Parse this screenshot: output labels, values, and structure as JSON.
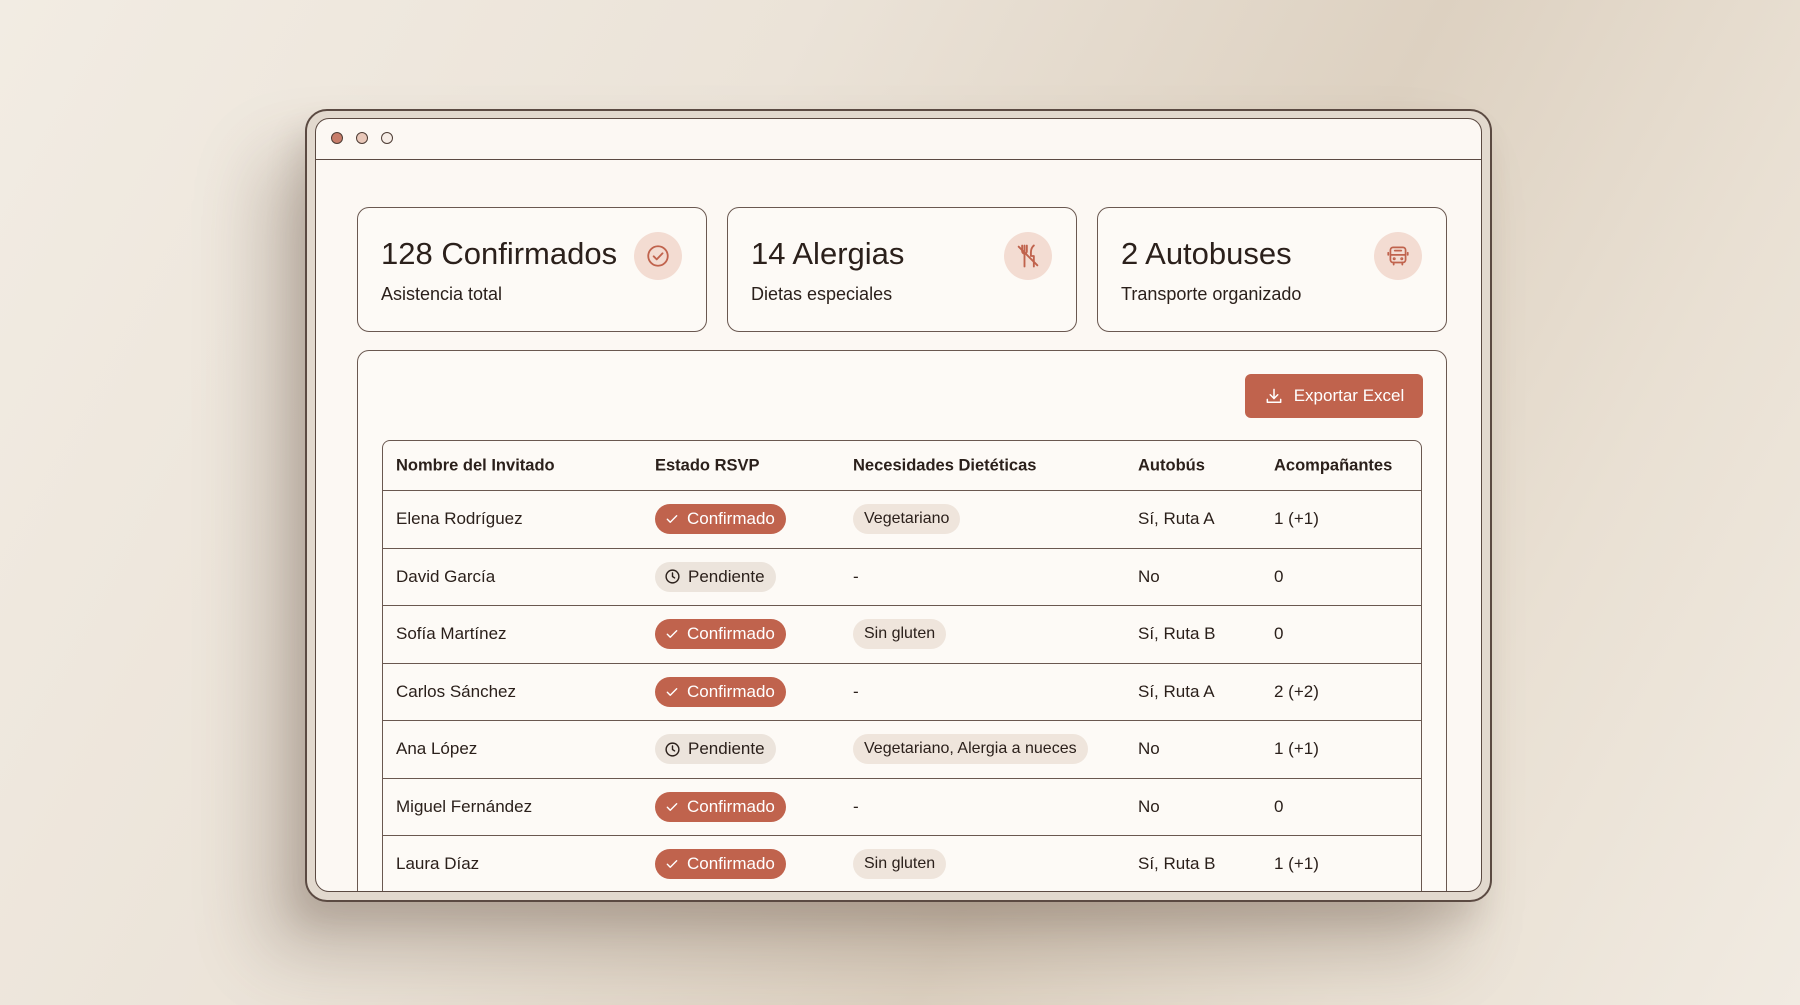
{
  "stats": [
    {
      "title": "128 Confirmados",
      "subtitle": "Asistencia total",
      "icon": "check-circle-icon"
    },
    {
      "title": "14 Alergias",
      "subtitle": "Dietas especiales",
      "icon": "no-utensils-icon"
    },
    {
      "title": "2 Autobuses",
      "subtitle": "Transporte organizado",
      "icon": "bus-icon"
    }
  ],
  "toolbar": {
    "export_label": "Exportar Excel",
    "export_icon": "download-icon"
  },
  "table": {
    "headers": [
      "Nombre del Invitado",
      "Estado RSVP",
      "Necesidades Dietéticas",
      "Autobús",
      "Acompañantes"
    ],
    "rows": [
      {
        "name": "Elena Rodríguez",
        "status": "Confirmado",
        "diet": "Vegetariano",
        "bus": "Sí, Ruta A",
        "companions": "1 (+1)"
      },
      {
        "name": "David García",
        "status": "Pendiente",
        "diet": "-",
        "bus": "No",
        "companions": "0"
      },
      {
        "name": "Sofía Martínez",
        "status": "Confirmado",
        "diet": "Sin gluten",
        "bus": "Sí, Ruta B",
        "companions": "0"
      },
      {
        "name": "Carlos Sánchez",
        "status": "Confirmado",
        "diet": "-",
        "bus": "Sí, Ruta A",
        "companions": "2 (+2)"
      },
      {
        "name": "Ana López",
        "status": "Pendiente",
        "diet": "Vegetariano, Alergia a nueces",
        "bus": "No",
        "companions": "1 (+1)"
      },
      {
        "name": "Miguel Fernández",
        "status": "Confirmado",
        "diet": "-",
        "bus": "No",
        "companions": "0"
      },
      {
        "name": "Laura Díaz",
        "status": "Confirmado",
        "diet": "Sin gluten",
        "bus": "Sí, Ruta B",
        "companions": "1 (+1)"
      }
    ]
  },
  "colors": {
    "accent": "#c0634d",
    "icon_bg": "#f3dcd2",
    "pending_bg": "#ece4dc",
    "diet_bg": "#efe5dc",
    "border": "#6a5850"
  }
}
